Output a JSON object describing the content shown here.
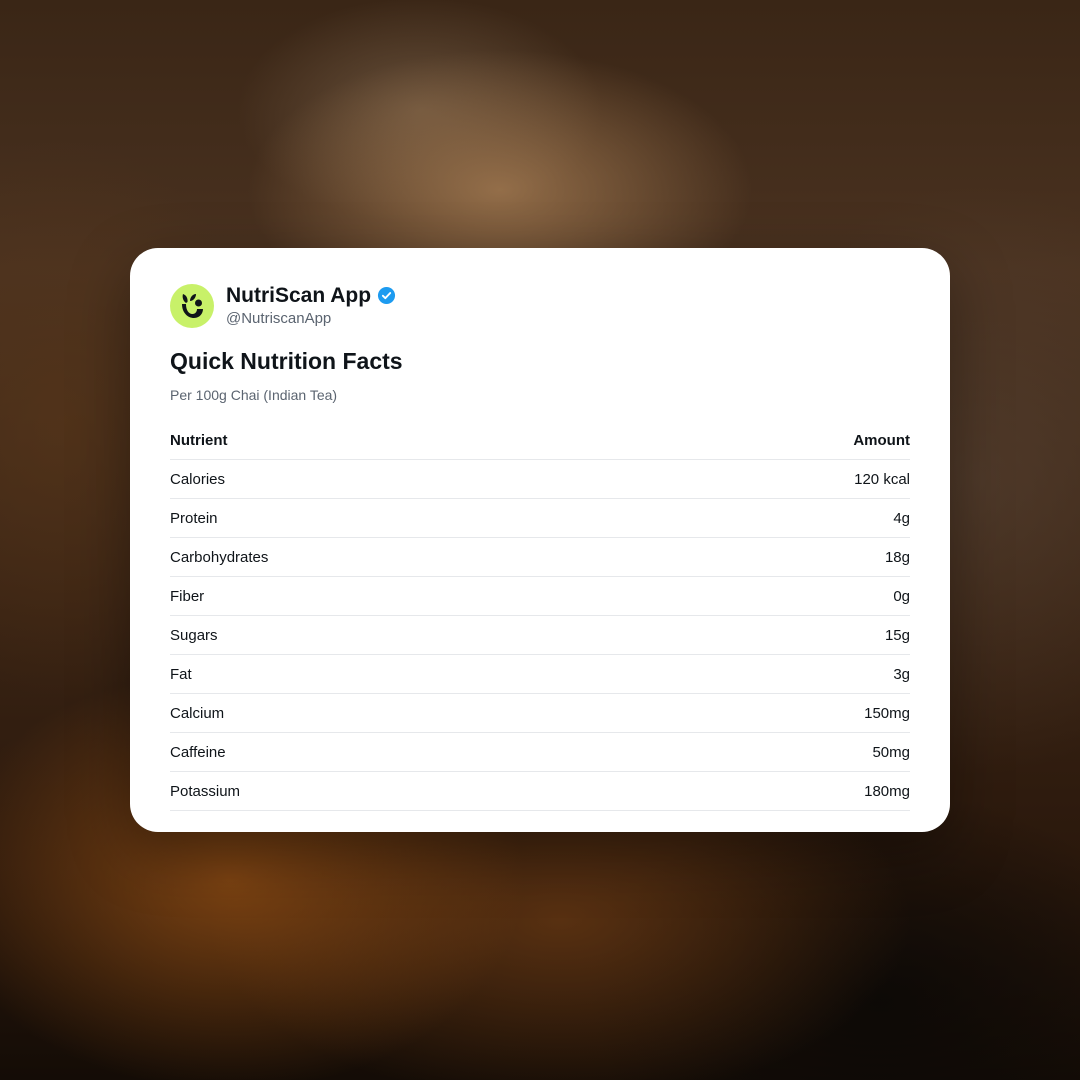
{
  "post": {
    "account_name": "NutriScan App",
    "handle": "@NutriscanApp",
    "verified": true,
    "avatar_icon": "nutriscan-leaf-logo-icon",
    "verified_icon": "verified-badge-icon",
    "accent_color": "#c8f169",
    "verified_color": "#1d9bf0"
  },
  "card": {
    "title": "Quick Nutrition Facts",
    "subtitle": "Per 100g Chai (Indian Tea)"
  },
  "table": {
    "headers": [
      "Nutrient",
      "Amount"
    ],
    "rows": [
      {
        "nutrient": "Calories",
        "amount": "120 kcal"
      },
      {
        "nutrient": "Protein",
        "amount": "4g"
      },
      {
        "nutrient": "Carbohydrates",
        "amount": "18g"
      },
      {
        "nutrient": "Fiber",
        "amount": "0g"
      },
      {
        "nutrient": "Sugars",
        "amount": "15g"
      },
      {
        "nutrient": "Fat",
        "amount": "3g"
      },
      {
        "nutrient": "Calcium",
        "amount": "150mg"
      },
      {
        "nutrient": "Caffeine",
        "amount": "50mg"
      },
      {
        "nutrient": "Potassium",
        "amount": "180mg"
      }
    ]
  }
}
